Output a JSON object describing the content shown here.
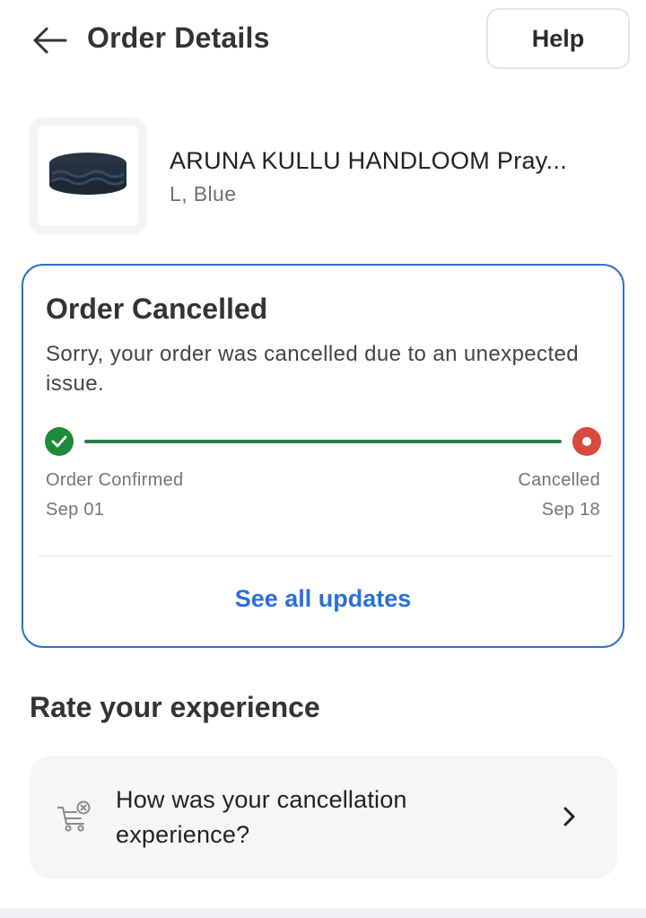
{
  "header": {
    "title": "Order Details",
    "help_label": "Help",
    "back_icon": "arrow-left-icon"
  },
  "product": {
    "name": "ARUNA KULLU HANDLOOM Pray...",
    "variant": "L, Blue"
  },
  "status": {
    "title": "Order Cancelled",
    "description": "Sorry, your order was cancelled due to an unexpected issue.",
    "timeline": {
      "start_label": "Order Confirmed",
      "start_date": "Sep 01",
      "end_label": "Cancelled",
      "end_date": "Sep 18"
    },
    "see_updates_label": "See all updates",
    "colors": {
      "accent": "#2f6fcc",
      "success": "#1e8a3a",
      "line": "#2e7d4c",
      "cancelled": "#d94a3d"
    }
  },
  "rating": {
    "title": "Rate your experience",
    "prompt": "How was your cancellation experience?",
    "icon": "cart-cancel-icon",
    "chevron": "chevron-right-icon"
  }
}
